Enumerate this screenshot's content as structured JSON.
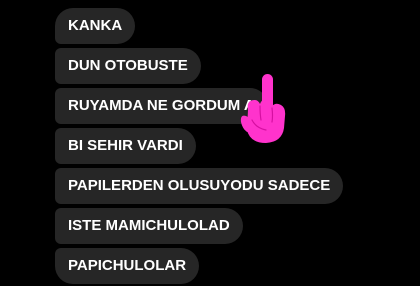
{
  "chat": {
    "messages": [
      {
        "text": "KANKA"
      },
      {
        "text": "DUN OTOBUSTE"
      },
      {
        "text": "RUYAMDA NE GORDUM A"
      },
      {
        "text": "BI SEHIR VARDI"
      },
      {
        "text": "PAPILERDEN OLUSUYODU SADECE"
      },
      {
        "text": "ISTE MAMICHULOLAD"
      },
      {
        "text": "PAPICHULOLAR"
      }
    ],
    "bubble_color": "#262626",
    "text_color": "#ffffff",
    "background_color": "#000000"
  },
  "sticker": {
    "icon": "pointing-up-hand-sticker-icon",
    "color": "#ff33cc"
  }
}
